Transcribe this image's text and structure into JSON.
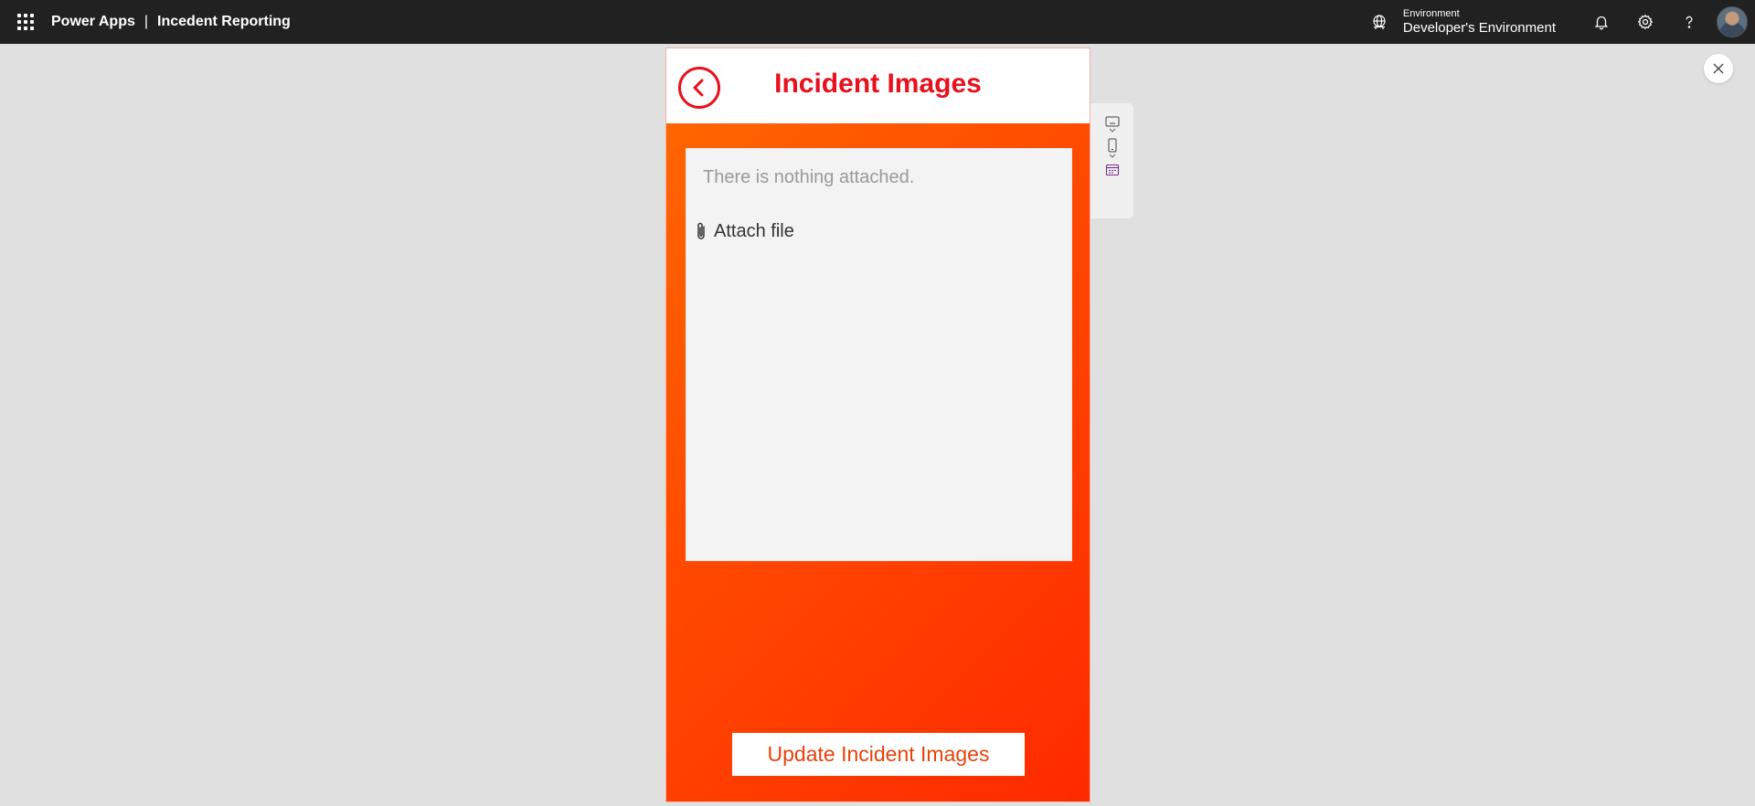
{
  "topbar": {
    "app_name": "Power Apps",
    "separator": "|",
    "app_title": "Incedent Reporting",
    "environment_label": "Environment",
    "environment_name": "Developer's Environment"
  },
  "screen": {
    "title": "Incident Images",
    "attachments_empty_text": "There is nothing attached.",
    "attach_file_label": "Attach file",
    "update_button_label": "Update Incident Images"
  },
  "colors": {
    "topbar_bg": "#212121",
    "accent_red": "#e8101c",
    "gradient_start": "#ff6a00",
    "gradient_end": "#ff2a00",
    "update_text": "#e8420a"
  },
  "icons": {
    "waffle": "app-launcher-icon",
    "environment": "environment-icon",
    "notifications": "bell-icon",
    "settings": "gear-icon",
    "help": "help-icon",
    "close": "close-icon",
    "back": "chevron-left-icon",
    "attach": "paperclip-icon"
  }
}
